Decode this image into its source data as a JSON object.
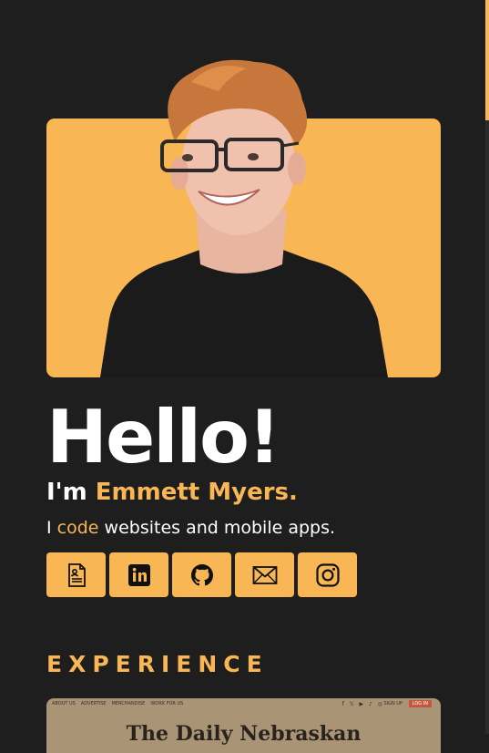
{
  "hero": {
    "greeting": "Hello!",
    "intro_prefix": "I'm ",
    "name": "Emmett Myers.",
    "tagline_prefix": "I ",
    "tagline_accent": "code",
    "tagline_suffix": " websites and mobile apps."
  },
  "socials": [
    {
      "icon": "resume-icon"
    },
    {
      "icon": "linkedin-icon"
    },
    {
      "icon": "github-icon"
    },
    {
      "icon": "mail-icon"
    },
    {
      "icon": "instagram-icon"
    }
  ],
  "experience": {
    "heading": "EXPERIENCE",
    "preview": {
      "nav": [
        "ABOUT US",
        "ADVERTISE",
        "MERCHANDISE",
        "WORK FOR US"
      ],
      "social_glyphs": "f 𝕏 ▶ ♪ ◎",
      "signup": "SIGN UP",
      "login": "LOG IN",
      "masthead": "The Daily Nebraskan"
    }
  },
  "colors": {
    "accent": "#f9b655",
    "background": "#1e1e1e"
  }
}
